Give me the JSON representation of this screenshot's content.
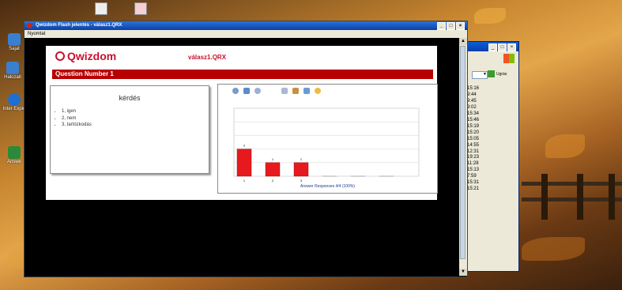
{
  "desktop": {
    "icons": [
      {
        "label": "Sajat",
        "color": "#3a7fd0"
      },
      {
        "label": "Halozati",
        "color": "#3a7fd0"
      },
      {
        "label": "Inter Explo",
        "color": "#1f6fd0"
      },
      {
        "label": "Answe",
        "color": "#2b8a3a"
      }
    ]
  },
  "bg_window": {
    "times": [
      "15:16",
      "9:44",
      "9:45",
      "9:02",
      "15:34",
      "15:46",
      "15:19",
      "15:20",
      "15:05",
      "14:55",
      "12:31",
      "19:23",
      "11:28",
      "15:13",
      "7:59",
      "15:31",
      "15:21"
    ],
    "go_label": "Ugrás"
  },
  "main_window": {
    "title": "Qwizdom Flash jelentés - válasz1.QRX",
    "menu_print": "Nyomtat"
  },
  "report": {
    "logo_text": "Qwizdom",
    "filename": "válasz1.QRX",
    "question_number": "Question Number 1",
    "question_title": "kérdés",
    "options": [
      "1, igen",
      "2, nem",
      "3, tartózkodás"
    ],
    "accent": "#b80000"
  },
  "chart_data": {
    "type": "bar",
    "categories": [
      "1",
      "2",
      "3",
      "4",
      "5",
      "6"
    ],
    "values": [
      2,
      1,
      1,
      0,
      0,
      0
    ],
    "ylim": [
      0,
      5
    ],
    "grid": true,
    "bar_color": "#e8191e",
    "xlabel": "Answer Responses 4/4 (100%)"
  }
}
